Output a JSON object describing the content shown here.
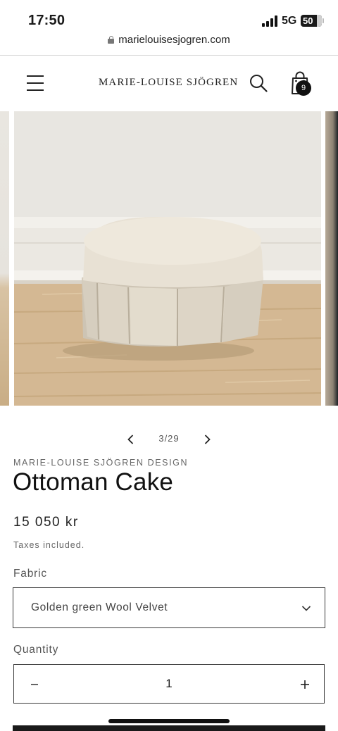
{
  "status_bar": {
    "time": "17:50",
    "network": "5G",
    "battery": "50"
  },
  "browser": {
    "url": "marielouisesjogren.com"
  },
  "header": {
    "brand": "MARIE-LOUISE SJÖGREN",
    "cart_count": "9",
    "icons": [
      "menu-icon",
      "search-icon",
      "bag-icon"
    ]
  },
  "gallery": {
    "current": "3/29"
  },
  "product": {
    "vendor": "MARIE-LOUISE SJÖGREN DESIGN",
    "title": "Ottoman Cake",
    "price": "15 050 kr",
    "tax_note": "Taxes included."
  },
  "options": {
    "fabric_label": "Fabric",
    "fabric_value": "Golden green Wool Velvet",
    "quantity_label": "Quantity",
    "quantity_value": "1"
  },
  "colors": {
    "text": "#1a1a1a",
    "muted": "#666666",
    "border": "#3a3a3a",
    "badge": "#111111"
  }
}
